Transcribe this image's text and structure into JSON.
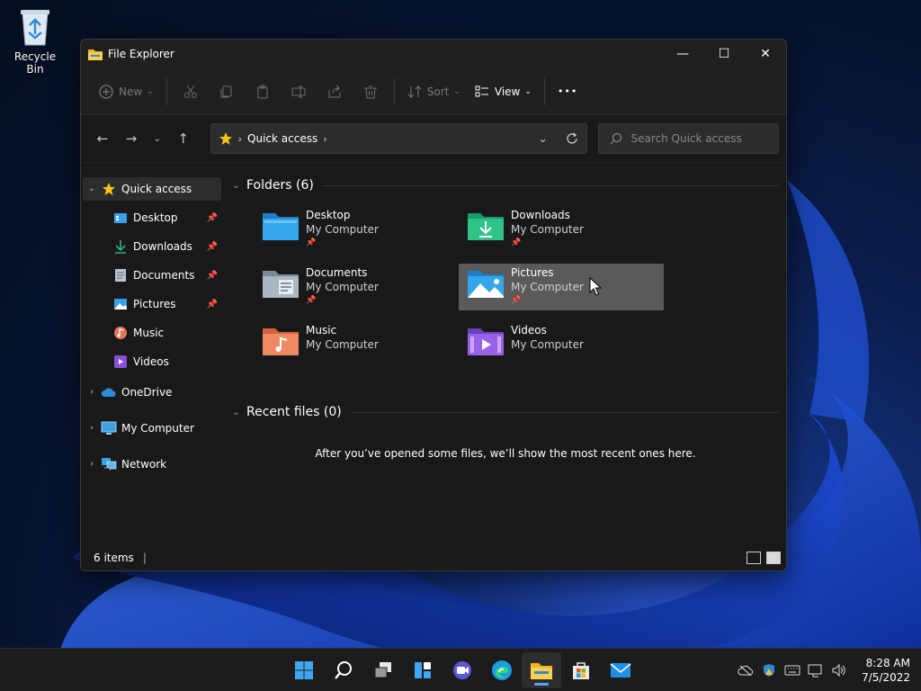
{
  "desktop": {
    "icons": [
      {
        "label": "Recycle Bin",
        "icon": "recycle-bin-icon"
      }
    ]
  },
  "window": {
    "title": "File Explorer",
    "controls": {
      "minimize": "—",
      "maximize": "☐",
      "close": "✕"
    }
  },
  "commandbar": {
    "new_label": "New",
    "sort_label": "Sort",
    "view_label": "View",
    "more_label": "•••",
    "disabled_icons": [
      "cut-icon",
      "copy-icon",
      "paste-icon",
      "rename-icon",
      "share-icon",
      "delete-icon"
    ]
  },
  "navigation": {
    "back": "←",
    "forward": "→",
    "recent": "⌄",
    "up": "↑",
    "address": {
      "location": "Quick access"
    },
    "search": {
      "placeholder": "Search Quick access",
      "value": ""
    }
  },
  "sidebar": {
    "quick_access": {
      "label": "Quick access"
    },
    "items": [
      {
        "label": "Desktop",
        "pinned": true,
        "icon": "desktop-folder-icon"
      },
      {
        "label": "Downloads",
        "pinned": true,
        "icon": "downloads-icon"
      },
      {
        "label": "Documents",
        "pinned": true,
        "icon": "documents-icon"
      },
      {
        "label": "Pictures",
        "pinned": true,
        "icon": "pictures-icon"
      },
      {
        "label": "Music",
        "pinned": false,
        "icon": "music-icon"
      },
      {
        "label": "Videos",
        "pinned": false,
        "icon": "videos-icon"
      }
    ],
    "roots": [
      {
        "label": "OneDrive",
        "icon": "onedrive-icon"
      },
      {
        "label": "My Computer",
        "icon": "computer-icon"
      },
      {
        "label": "Network",
        "icon": "network-icon"
      }
    ]
  },
  "content": {
    "folders_header": "Folders (6)",
    "folders": [
      {
        "name": "Desktop",
        "location": "My Computer",
        "pinned": true
      },
      {
        "name": "Downloads",
        "location": "My Computer",
        "pinned": true
      },
      {
        "name": "Documents",
        "location": "My Computer",
        "pinned": true
      },
      {
        "name": "Pictures",
        "location": "My Computer",
        "pinned": true
      },
      {
        "name": "Music",
        "location": "My Computer",
        "pinned": false
      },
      {
        "name": "Videos",
        "location": "My Computer",
        "pinned": false
      }
    ],
    "recent_header": "Recent files (0)",
    "recent_empty_text": "After you’ve opened some files, we’ll show the most recent ones here."
  },
  "statusbar": {
    "items_count": "6 items",
    "caret": "|"
  },
  "taskbar": {
    "apps": [
      "start-icon",
      "search-icon",
      "task-view-icon",
      "widgets-icon",
      "chat-icon",
      "edge-icon",
      "file-explorer-icon",
      "store-icon",
      "mail-icon"
    ],
    "active_app": "file-explorer-icon",
    "clock": {
      "time": "8:28 AM",
      "date": "7/5/2022"
    }
  },
  "colors": {
    "accent": "#5aa0ff",
    "window_bg": "#202020",
    "hover_tile": "#5a5a5a"
  }
}
